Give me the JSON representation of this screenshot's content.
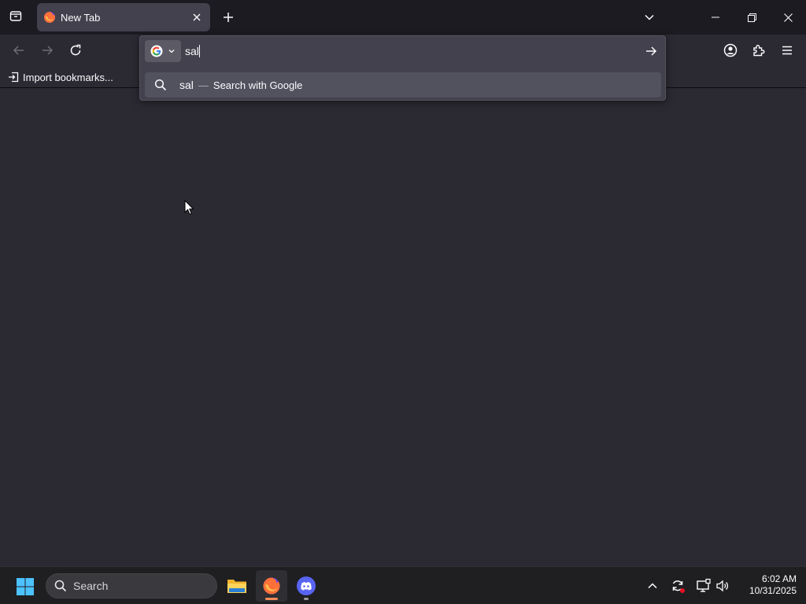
{
  "browser": {
    "tab": {
      "title": "New Tab"
    },
    "urlbar": {
      "value": "sal",
      "suggestion": {
        "query": "sal",
        "separator": "—",
        "action": "Search with Google"
      }
    },
    "bookmarks": {
      "import_label": "Import bookmarks..."
    }
  },
  "taskbar": {
    "search_placeholder": "Search",
    "clock": {
      "time": "6:02 AM",
      "date": "10/31/2025"
    }
  },
  "colors": {
    "titlebar": "#1c1b22",
    "toolbar": "#2b2a33",
    "tab_active": "#42414d",
    "urlbar": "#42414d",
    "suggestion_highlight": "#52515e",
    "taskbar": "#1f1f22",
    "firefox_indicator": "#f28b5b"
  },
  "icons": {
    "tabs_overview": "firefox-view-icon",
    "favicon": "firefox-icon",
    "tab_close": "close-icon",
    "new_tab": "plus-icon",
    "list_tabs": "chevron-down-icon",
    "minimize": "minimize-icon",
    "maximize": "restore-icon",
    "close": "close-icon",
    "back": "arrow-left-icon",
    "forward": "arrow-right-icon",
    "reload": "reload-icon",
    "search_engine": "google-icon",
    "go": "arrow-right-icon",
    "account": "account-icon",
    "extensions": "puzzle-icon",
    "menu": "hamburger-icon",
    "start": "windows-icon",
    "explorer": "folder-icon",
    "discord": "discord-icon"
  }
}
